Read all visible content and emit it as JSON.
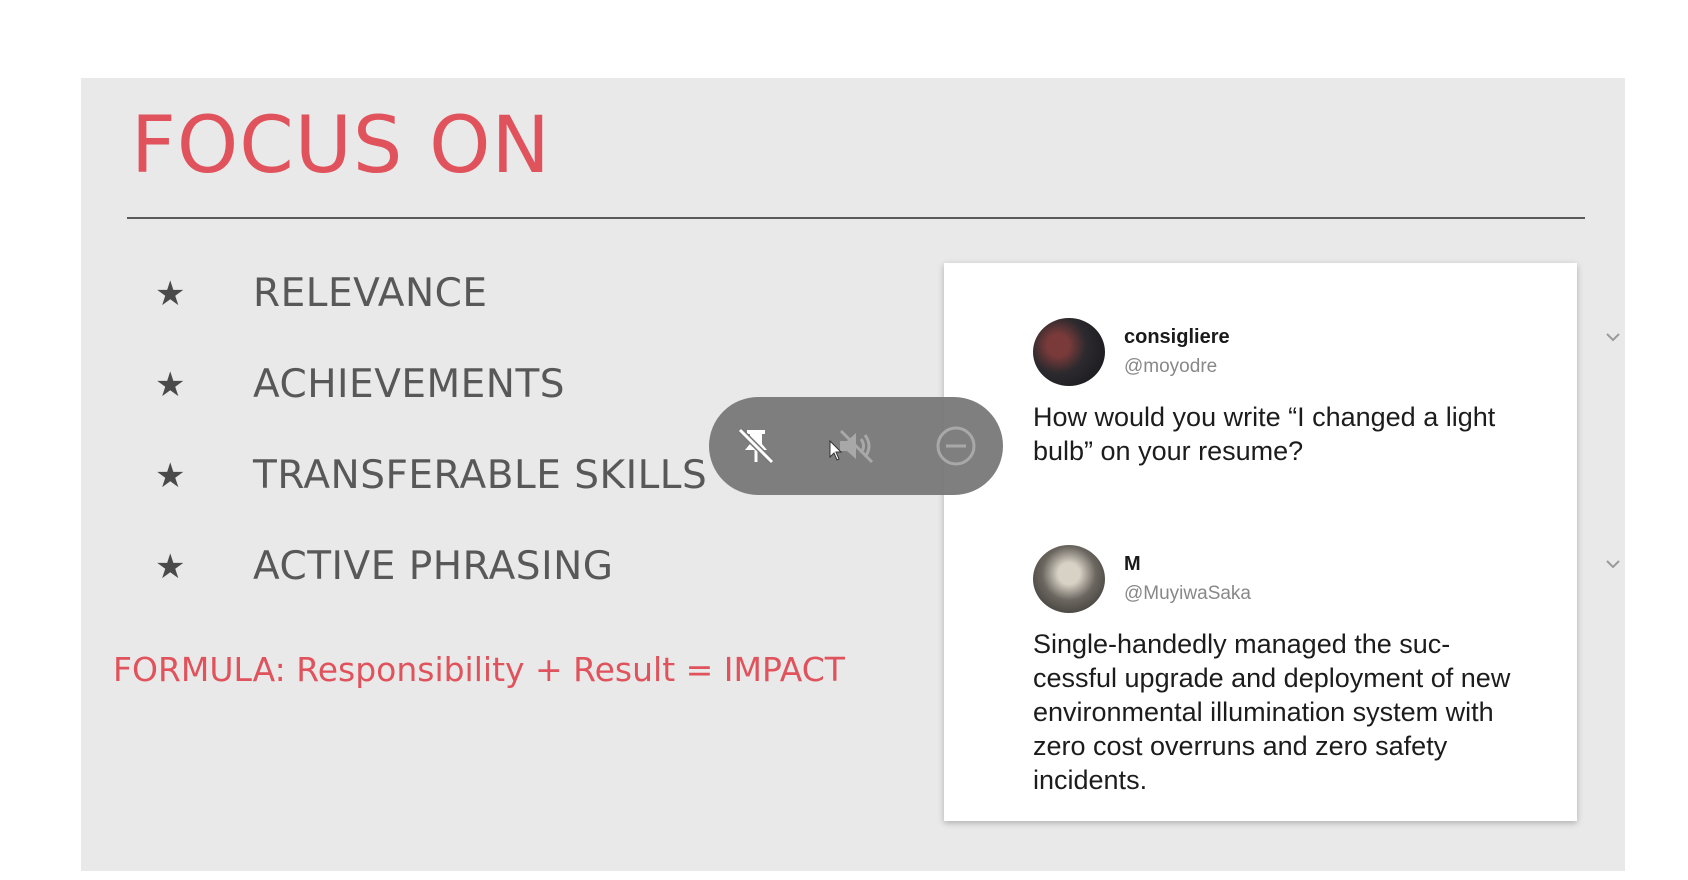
{
  "slide": {
    "title": "FOCUS ON",
    "bullets": [
      {
        "label": "RELEVANCE"
      },
      {
        "label": "ACHIEVEMENTS"
      },
      {
        "label": "TRANSFERABLE SKILLS"
      },
      {
        "label": "ACTIVE PHRASING"
      }
    ],
    "formula": "FORMULA: Responsibility + Result = IMPACT"
  },
  "tweets": [
    {
      "display_name": "consigliere",
      "handle": "@moyodre",
      "text": "How would you write “I changed a light bulb” on your resume?"
    },
    {
      "display_name": "M",
      "handle": "@MuyiwaSaka",
      "text": "Single-handedly managed the suc-cessful upgrade and deployment of new environmental illumination system with zero cost overruns and zero safety incidents."
    }
  ],
  "overlay_controls": {
    "icons": [
      "unpin-icon",
      "mute-icon",
      "remove-icon"
    ]
  },
  "colors": {
    "accent": "#e0535c",
    "slide_bg": "#e9e9e9",
    "text_gray": "#585858",
    "pill_bg": "#787878"
  }
}
